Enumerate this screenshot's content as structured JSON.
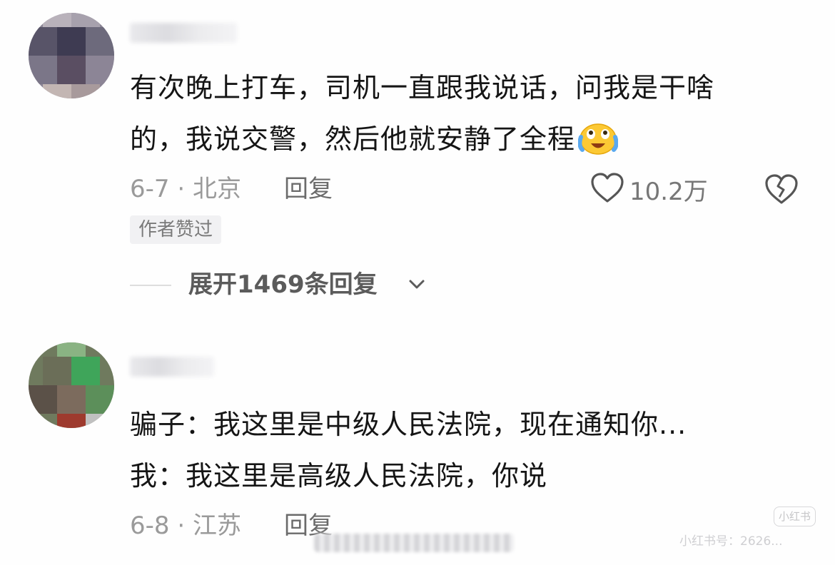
{
  "comments": [
    {
      "text_line1": "有次晚上打车，司机一直跟我说话，问我是干啥",
      "text_line2": "的，我说交警，然后他就安静了全程",
      "date_location": "6-7 · 北京",
      "reply_label": "回复",
      "like_count": "10.2万",
      "badge": "作者赞过",
      "expand_replies": "展开1469条回复"
    },
    {
      "text_line1": "骗子：我这里是中级人民法院，现在通知你...",
      "text_line2": "我：我这里是高级人民法院，你说",
      "date_location": "6-8 · 江苏",
      "reply_label": "回复"
    }
  ],
  "watermark": {
    "logo": "小红书",
    "text": "小红书号：2626..."
  },
  "icons": {
    "emoji": "crying-laughing-emoji",
    "like": "heart-outline-icon",
    "dislike": "broken-heart-icon",
    "expand": "chevron-down-icon"
  },
  "colors": {
    "text_primary": "#151515",
    "text_meta": "#9a9a9a",
    "badge_bg": "#f1f1f3"
  }
}
